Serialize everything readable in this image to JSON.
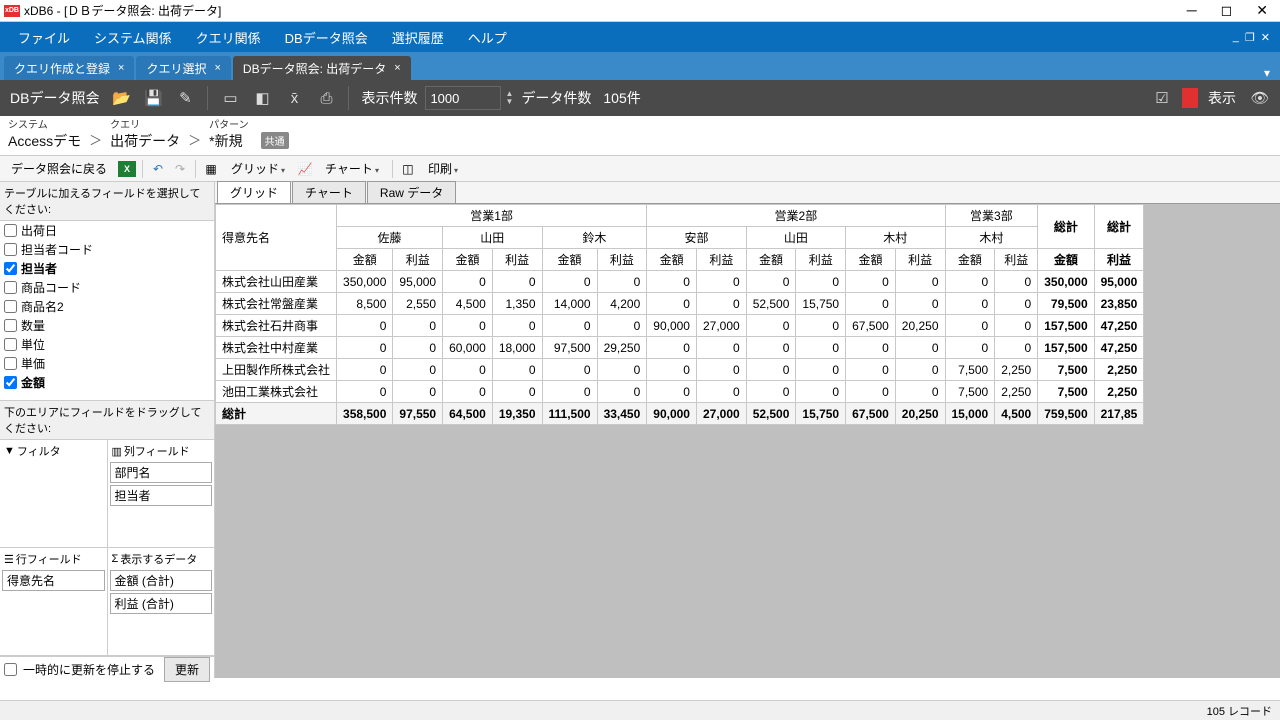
{
  "window": {
    "title": "xDB6 - [ＤＢデータ照会: 出荷データ]"
  },
  "menu": {
    "items": [
      "ファイル",
      "システム関係",
      "クエリ関係",
      "DBデータ照会",
      "選択履歴",
      "ヘルプ"
    ]
  },
  "tabs": [
    {
      "label": "クエリ作成と登録",
      "active": false
    },
    {
      "label": "クエリ選択",
      "active": false
    },
    {
      "label": "DBデータ照会: 出荷データ",
      "active": true
    }
  ],
  "toolbar1": {
    "app_label": "DBデータ照会",
    "disp_count_label": "表示件数",
    "disp_count_value": "1000",
    "data_count_label": "データ件数",
    "data_count_value": "105件",
    "show_label": "表示"
  },
  "breadcrumb": {
    "system_lbl": "システム",
    "system_val": "Accessデモ",
    "query_lbl": "クエリ",
    "query_val": "出荷データ",
    "pattern_lbl": "パターン",
    "pattern_val": "*新規",
    "badge": "共通"
  },
  "toolbar2": {
    "back": "データ照会に戻る",
    "grid": "グリッド",
    "chart": "チャート",
    "print": "印刷"
  },
  "fieldpanel": {
    "header": "テーブルに加えるフィールドを選択してください:",
    "fields": [
      {
        "label": "出荷日",
        "checked": false
      },
      {
        "label": "担当者コード",
        "checked": false
      },
      {
        "label": "担当者",
        "checked": true
      },
      {
        "label": "商品コード",
        "checked": false
      },
      {
        "label": "商品名2",
        "checked": false
      },
      {
        "label": "数量",
        "checked": false
      },
      {
        "label": "単位",
        "checked": false
      },
      {
        "label": "単価",
        "checked": false
      },
      {
        "label": "金額",
        "checked": true
      }
    ],
    "drag_hint": "下のエリアにフィールドをドラッグしてください:",
    "filter_hdr": "フィルタ",
    "colfield_hdr": "列フィールド",
    "colfields": [
      "部門名",
      "担当者"
    ],
    "rowfield_hdr": "行フィールド",
    "rowfields": [
      "得意先名"
    ],
    "data_hdr": "表示するデータ",
    "datafields": [
      "金額 (合計)",
      "利益 (合計)"
    ],
    "pause": "一時的に更新を停止する",
    "update_btn": "更新"
  },
  "viewtabs": [
    "グリッド",
    "チャート",
    "Raw データ"
  ],
  "pivot": {
    "corner": "得意先名",
    "groups": [
      {
        "name": "営業1部",
        "subs": [
          "佐藤",
          "山田",
          "鈴木"
        ]
      },
      {
        "name": "営業2部",
        "subs": [
          "安部",
          "山田",
          "木村"
        ]
      },
      {
        "name": "営業3部",
        "subs": [
          "木村"
        ]
      }
    ],
    "measures": [
      "金額",
      "利益"
    ],
    "grand_col": "総計",
    "rows": [
      {
        "name": "株式会社山田産業",
        "vals": [
          "350,000",
          "95,000",
          "0",
          "0",
          "0",
          "0",
          "0",
          "0",
          "0",
          "0",
          "0",
          "0",
          "0",
          "0"
        ],
        "tot": [
          "350,000",
          "95,000"
        ]
      },
      {
        "name": "株式会社常盤産業",
        "vals": [
          "8,500",
          "2,550",
          "4,500",
          "1,350",
          "14,000",
          "4,200",
          "0",
          "0",
          "52,500",
          "15,750",
          "0",
          "0",
          "0",
          "0"
        ],
        "tot": [
          "79,500",
          "23,850"
        ]
      },
      {
        "name": "株式会社石井商事",
        "vals": [
          "0",
          "0",
          "0",
          "0",
          "0",
          "0",
          "90,000",
          "27,000",
          "0",
          "0",
          "67,500",
          "20,250",
          "0",
          "0"
        ],
        "tot": [
          "157,500",
          "47,250"
        ]
      },
      {
        "name": "株式会社中村産業",
        "vals": [
          "0",
          "0",
          "60,000",
          "18,000",
          "97,500",
          "29,250",
          "0",
          "0",
          "0",
          "0",
          "0",
          "0",
          "0",
          "0"
        ],
        "tot": [
          "157,500",
          "47,250"
        ]
      },
      {
        "name": "上田製作所株式会社",
        "vals": [
          "0",
          "0",
          "0",
          "0",
          "0",
          "0",
          "0",
          "0",
          "0",
          "0",
          "0",
          "0",
          "7,500",
          "2,250"
        ],
        "tot": [
          "7,500",
          "2,250"
        ]
      },
      {
        "name": "池田工業株式会社",
        "vals": [
          "0",
          "0",
          "0",
          "0",
          "0",
          "0",
          "0",
          "0",
          "0",
          "0",
          "0",
          "0",
          "7,500",
          "2,250"
        ],
        "tot": [
          "7,500",
          "2,250"
        ]
      }
    ],
    "total_label": "総計",
    "total_vals": [
      "358,500",
      "97,550",
      "64,500",
      "19,350",
      "111,500",
      "33,450",
      "90,000",
      "27,000",
      "52,500",
      "15,750",
      "67,500",
      "20,250",
      "15,000",
      "4,500"
    ],
    "total_tot": [
      "759,500",
      "217,85"
    ]
  },
  "status": {
    "records": "105 レコード"
  }
}
